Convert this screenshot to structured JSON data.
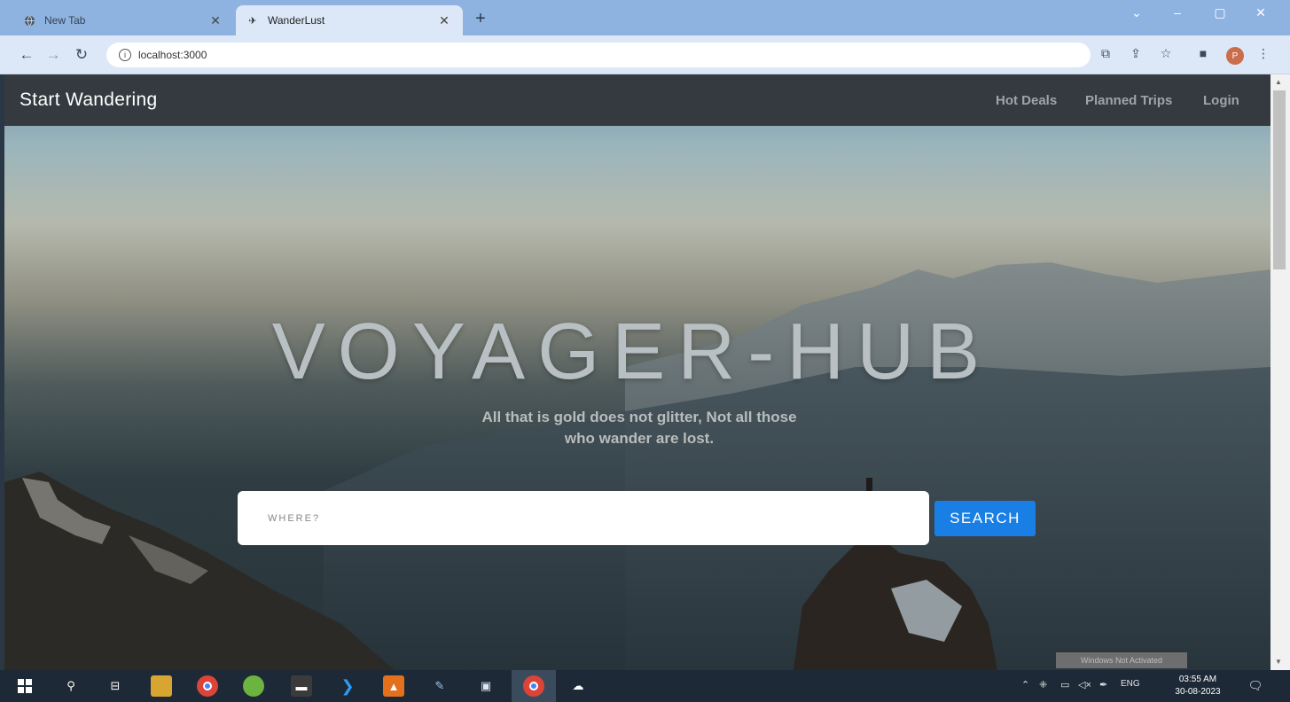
{
  "browser": {
    "tabs": [
      {
        "title": "New Tab",
        "icon": "globe-icon"
      },
      {
        "title": "WanderLust",
        "icon": "plane-icon"
      }
    ],
    "url": "localhost:3000"
  },
  "site": {
    "brand": "Start Wandering",
    "nav": [
      "Hot Deals",
      "Planned Trips",
      "Login"
    ],
    "hero_title": "VOYAGER-HUB",
    "subtitle_line1": "All that is gold does not glitter, Not all those",
    "subtitle_line2": "who wander are lost.",
    "search_placeholder": "WHERE?",
    "search_button": "SEARCH"
  },
  "overlay": {
    "watermark": "Windows Not Activated"
  },
  "taskbar": {
    "tray_lang": "ENG",
    "time": "03:55 AM",
    "date": "30-08-2023"
  },
  "colors": {
    "navbar": "#343a40",
    "accent": "#1a7fe5",
    "taskbar": "#1d2936"
  }
}
